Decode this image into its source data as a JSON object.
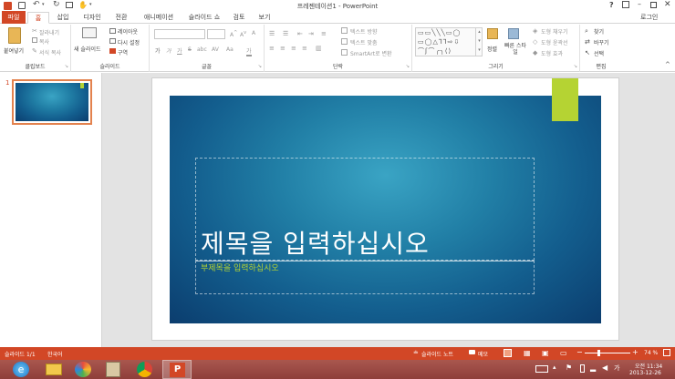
{
  "window": {
    "title": "프레젠테이션1 - PowerPoint",
    "user": "로그인",
    "help_icon": "question-icon",
    "controls": [
      "minimize-icon",
      "ribbon-display-icon",
      "restore-icon",
      "close-icon"
    ]
  },
  "qat": {
    "icons": [
      "powerpoint-icon",
      "save-icon",
      "undo-icon",
      "redo-icon",
      "start-slideshow-icon",
      "touch-mode-icon"
    ]
  },
  "tabs": [
    {
      "label": "파일",
      "type": "file"
    },
    {
      "label": "홈",
      "type": "active"
    },
    {
      "label": "삽입"
    },
    {
      "label": "디자인"
    },
    {
      "label": "전환"
    },
    {
      "label": "애니메이션"
    },
    {
      "label": "슬라이드 쇼"
    },
    {
      "label": "검토"
    },
    {
      "label": "보기"
    }
  ],
  "ribbon": {
    "clipboard": {
      "label": "클립보드",
      "paste": "붙여넣기",
      "cut": "잘라내기",
      "copy": "복사",
      "format_painter": "서식 복사"
    },
    "slides": {
      "label": "슬라이드",
      "new_slide": "새 슬라이드",
      "layout": "레이아웃",
      "reset": "다시 설정",
      "section": "구역"
    },
    "font": {
      "label": "글꼴",
      "font_name": "",
      "font_size": "",
      "bold": "가",
      "italic": "가",
      "underline": "가",
      "strike": "S",
      "shadow": "abc",
      "spacing": "AV",
      "case": "Aa",
      "color": "가",
      "clear": "가"
    },
    "paragraph": {
      "label": "단락",
      "text_direction": "텍스트 방향",
      "align_text": "텍스트 맞춤",
      "smartart": "SmartArt로 변환"
    },
    "drawing": {
      "label": "그리기",
      "arrange": "정렬",
      "quick_styles": "빠른 스타일",
      "shape_fill": "도형 채우기",
      "shape_outline": "도형 윤곽선",
      "shape_effects": "도형 효과"
    },
    "editing": {
      "label": "편집",
      "find": "찾기",
      "replace": "바꾸기",
      "select": "선택"
    }
  },
  "thumbnails": [
    {
      "number": "1"
    }
  ],
  "slide": {
    "title_placeholder": "제목을 입력하십시오",
    "subtitle_placeholder": "부제목을 입력하십시오",
    "accent_color": "#b5d333",
    "title_color": "#ffffff",
    "subtitle_color": "#b5d333"
  },
  "status": {
    "slide_count": "슬라이드 1/1",
    "language": "한국어",
    "notes": "슬라이드 노트",
    "comments": "메모",
    "zoom": "74 %"
  },
  "taskbar": {
    "apps": [
      "ie-icon",
      "file-explorer-icon",
      "photo-app-icon",
      "notepad-icon",
      "chrome-icon",
      "powerpoint-icon"
    ],
    "time": "오전 11:34",
    "date": "2013-12-26"
  },
  "colors": {
    "accent": "#d24726",
    "ribbon_border": "#d5d5d5"
  }
}
